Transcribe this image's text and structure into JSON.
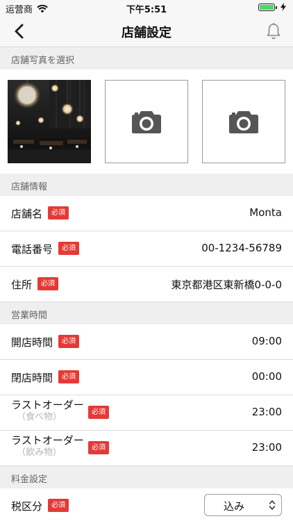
{
  "status_bar": {
    "carrier": "运营商",
    "time": "下午5:51"
  },
  "nav": {
    "title": "店舗設定"
  },
  "sections": {
    "photos": "店舗写真を選択",
    "info": "店舗情報",
    "hours": "営業時間",
    "pricing": "料金設定"
  },
  "badge": "必須",
  "info_rows": [
    {
      "label": "店舗名",
      "value": "Monta"
    },
    {
      "label": "電話番号",
      "value": "00-1234-56789"
    },
    {
      "label": "住所",
      "value": "東京都港区東新橋0-0-0"
    }
  ],
  "hours_rows": [
    {
      "label": "開店時間",
      "value": "09:00"
    },
    {
      "label": "閉店時間",
      "value": "00:00"
    },
    {
      "label": "ラストオーダー",
      "sub": "（食べ物）",
      "value": "23:00"
    },
    {
      "label": "ラストオーダー",
      "sub": "（飲み物）",
      "value": "23:00"
    }
  ],
  "pricing_rows": [
    {
      "label": "税区分",
      "value": "込み"
    }
  ],
  "colors": {
    "badge": "#e53935",
    "section_bg": "#efefef",
    "battery": "#4cd964"
  }
}
